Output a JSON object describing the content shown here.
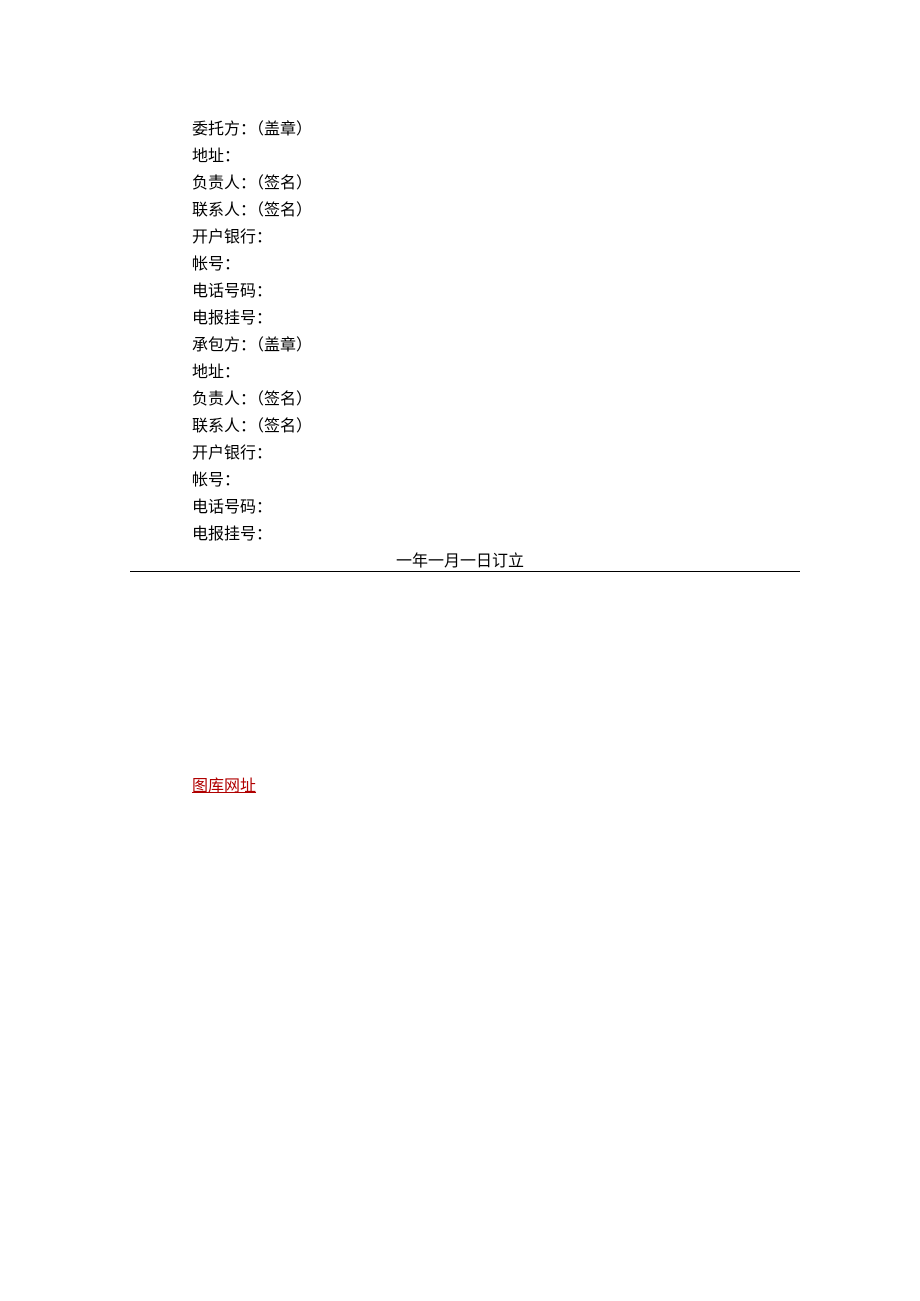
{
  "principal": {
    "title": "委托方：（盖章）",
    "address": "地址：",
    "responsible": "负责人：（签名）",
    "contact": "联系人：（签名）",
    "bank": "开户银行：",
    "account": "帐号：",
    "phone": "电话号码：",
    "telegram": "电报挂号："
  },
  "contractor": {
    "title": "承包方：（盖章）",
    "address": "地址：",
    "responsible": "负责人：（签名）",
    "contact": "联系人：（签名）",
    "bank": "开户银行：",
    "account": "帐号：",
    "phone": "电话号码：",
    "telegram": "电报挂号："
  },
  "date_line": "一年一月一日订立",
  "link_label": "图库网址"
}
